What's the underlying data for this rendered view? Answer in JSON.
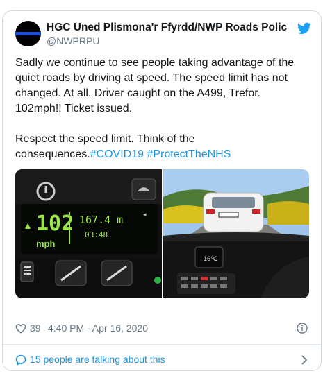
{
  "author": {
    "display_name": "HGC Uned Plismona'r Ffyrdd/NWP Roads Polic",
    "handle": "@NWPRPU"
  },
  "tweet": {
    "text": "Sadly we continue to see people taking advantage of the quiet roads by driving at speed. The speed limit has not changed. At all. Driver caught on the A499, Trefor. 102mph!! Ticket issued.\n\nRespect the speed limit. Think of the consequences.",
    "hashtags": [
      "#COVID19",
      "#ProtectTheNHS"
    ]
  },
  "media": {
    "speed_display": {
      "speed": "102",
      "speed_unit": "mph",
      "distance": "167.4 m",
      "time": "03:48"
    },
    "dash_display": "16℃"
  },
  "footer": {
    "likes": "39",
    "timestamp": "4:40 PM - Apr 16, 2020"
  },
  "conversation": {
    "label": "15 people are talking about this"
  },
  "colors": {
    "link": "#1b95e0",
    "secondary_text": "#657786",
    "border": "#cfd9de",
    "display_green": "#9be64b"
  },
  "icons": [
    "twitter-bird-icon",
    "heart-icon",
    "info-icon",
    "speech-bubble-icon",
    "chevron-right-icon"
  ]
}
